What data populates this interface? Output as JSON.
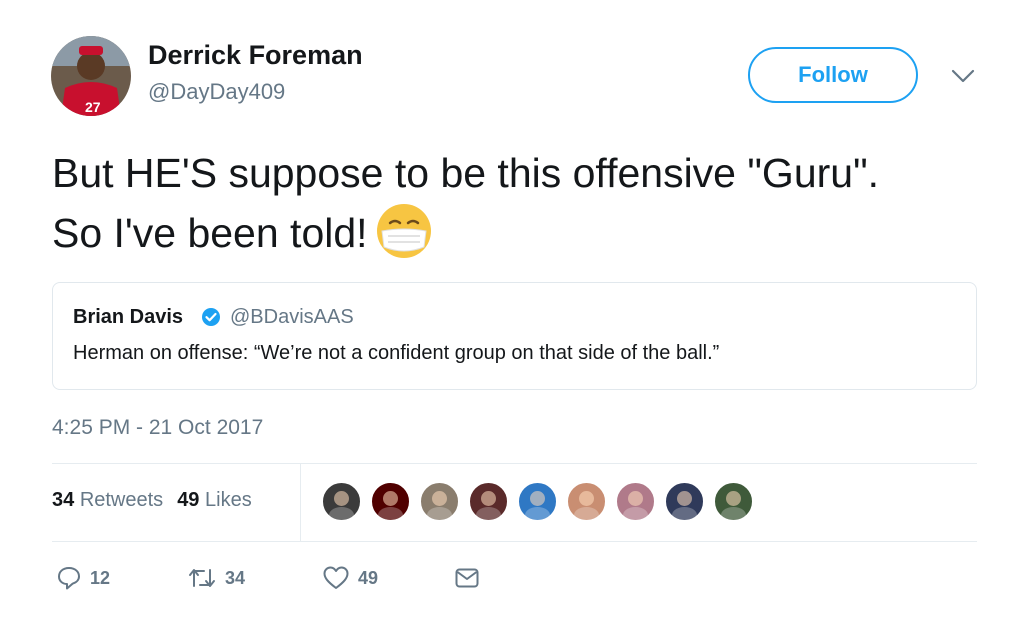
{
  "author": {
    "name": "Derrick Foreman",
    "handle": "@DayDay409",
    "avatar_icon": "avatar-person-red-jersey"
  },
  "follow_label": "Follow",
  "tweet": {
    "text": "But HE'S suppose to be this offensive \"Guru\". So I've been told!",
    "emoji_icon": "face-with-medical-mask-emoji"
  },
  "quoted": {
    "name": "Brian Davis",
    "handle": "@BDavisAAS",
    "text": "Herman on offense: “We’re not a confident group on that side of the ball.”"
  },
  "timestamp": "4:25 PM - 21 Oct 2017",
  "stats": {
    "retweets_count": "34",
    "retweets_label": "Retweets",
    "likes_count": "49",
    "likes_label": "Likes"
  },
  "likers": [
    {
      "icon": "liker-avatar-1",
      "color": "#3b3b3b"
    },
    {
      "icon": "liker-avatar-texas-am-logo",
      "color": "#500000"
    },
    {
      "icon": "liker-avatar-3",
      "color": "#8a7d6d"
    },
    {
      "icon": "liker-avatar-4",
      "color": "#5a2a2a"
    },
    {
      "icon": "liker-avatar-5",
      "color": "#2f78c4"
    },
    {
      "icon": "liker-avatar-6",
      "color": "#c98e72"
    },
    {
      "icon": "liker-avatar-7",
      "color": "#b07a8a"
    },
    {
      "icon": "liker-avatar-8",
      "color": "#2f3a5a"
    },
    {
      "icon": "liker-avatar-9",
      "color": "#3f5a3a"
    }
  ],
  "actions": {
    "reply_count": "12",
    "retweet_count": "34",
    "like_count": "49"
  },
  "colors": {
    "accent": "#1da1f2",
    "secondary_text": "#657786",
    "border": "#e1e8ed"
  }
}
